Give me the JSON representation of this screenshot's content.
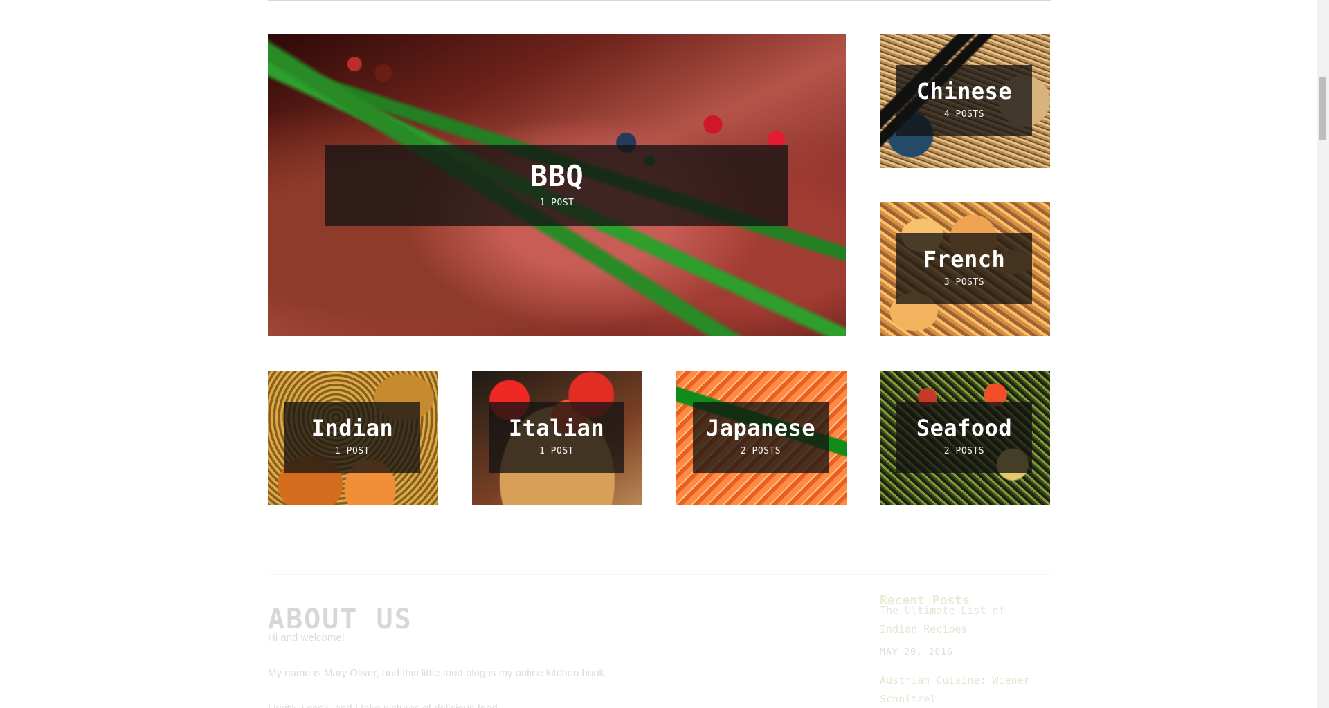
{
  "categories": [
    {
      "name": "BBQ",
      "count": "1 POST",
      "image_icon": "steak-image-icon"
    },
    {
      "name": "Chinese",
      "count": "4 POSTS",
      "image_icon": "noodles-image-icon"
    },
    {
      "name": "French",
      "count": "3 POSTS",
      "image_icon": "croissant-image-icon"
    },
    {
      "name": "Indian",
      "count": "1 POST",
      "image_icon": "curry-image-icon"
    },
    {
      "name": "Italian",
      "count": "1 POST",
      "image_icon": "pizza-image-icon"
    },
    {
      "name": "Japanese",
      "count": "2 POSTS",
      "image_icon": "sushi-image-icon"
    },
    {
      "name": "Seafood",
      "count": "2 POSTS",
      "image_icon": "seafood-image-icon"
    }
  ],
  "about": {
    "title": "ABOUT US",
    "paragraphs": [
      "Hi and welcome!",
      "My name is Mary Oliver, and this little food blog is my online kitchen book.",
      "I write, I cook, and I take pictures of delicious food."
    ]
  },
  "recent_posts": {
    "title": "Recent Posts",
    "items": [
      {
        "title": "The Ultimate List of Indian Recipes",
        "date": "MAY 20, 2016"
      },
      {
        "title": "Austrian Cuisine: Wiener Schnitzel"
      }
    ]
  },
  "colors": {
    "overlay": "#121212",
    "link": "#8b7e2f",
    "recent_title": "#a79c38"
  }
}
